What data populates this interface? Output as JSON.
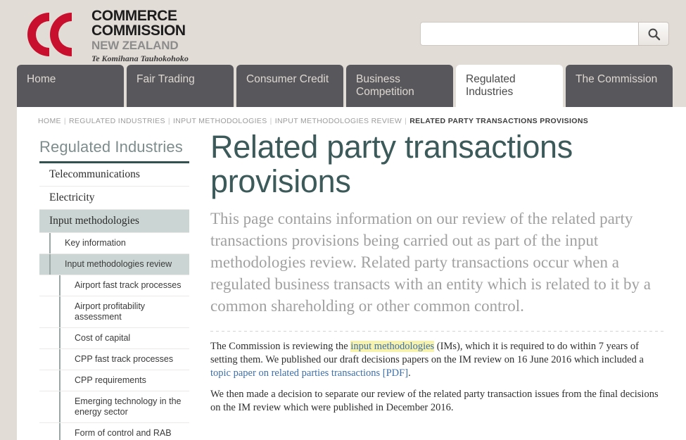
{
  "brand": {
    "line1": "COMMERCE",
    "line2": "COMMISSION",
    "line3": "NEW ZEALAND",
    "line4": "Te Komihana Tauhokohoko",
    "logo_color": "#c8102e",
    "logo_icon": "double-c-logo-icon"
  },
  "search": {
    "value": "",
    "placeholder": "",
    "icon": "search-icon",
    "button_label": ""
  },
  "tabs": [
    {
      "label": "Home",
      "active": false
    },
    {
      "label": "Fair Trading",
      "active": false
    },
    {
      "label": "Consumer Credit",
      "active": false
    },
    {
      "label": "Business Competition",
      "active": false
    },
    {
      "label": "Regulated Industries",
      "active": true
    },
    {
      "label": "The Commission",
      "active": false
    }
  ],
  "breadcrumb": {
    "items": [
      {
        "label": "HOME",
        "current": false
      },
      {
        "label": "REGULATED INDUSTRIES",
        "current": false
      },
      {
        "label": "INPUT METHODOLOGIES",
        "current": false
      },
      {
        "label": "INPUT METHODOLOGIES REVIEW",
        "current": false
      },
      {
        "label": "RELATED PARTY TRANSACTIONS PROVISIONS",
        "current": true
      }
    ],
    "separator": "|"
  },
  "sidebar": {
    "title": "Regulated Industries",
    "items": [
      {
        "label": "Telecommunications",
        "level": 1,
        "selected": false
      },
      {
        "label": "Electricity",
        "level": 1,
        "selected": false
      },
      {
        "label": "Input methodologies",
        "level": 1,
        "selected": true
      },
      {
        "label": "Key information",
        "level": 2,
        "selected": false
      },
      {
        "label": "Input methodologies review",
        "level": 2,
        "selected": true
      },
      {
        "label": "Airport fast track processes",
        "level": 3,
        "selected": false
      },
      {
        "label": "Airport profitability assessment",
        "level": 3,
        "selected": false
      },
      {
        "label": "Cost of capital",
        "level": 3,
        "selected": false
      },
      {
        "label": "CPP fast track processes",
        "level": 3,
        "selected": false
      },
      {
        "label": "CPP requirements",
        "level": 3,
        "selected": false
      },
      {
        "label": "Emerging technology in the energy sector",
        "level": 3,
        "selected": false
      },
      {
        "label": "Form of control and RAB",
        "level": 3,
        "selected": false
      }
    ]
  },
  "main": {
    "title": "Related party transactions provisions",
    "intro": "This page contains information on our review of the related party transactions provisions being carried out as part of the input methodologies review.  Related party transactions occur when a regulated business transacts with an entity which is related to it by a common shareholding or other common control.",
    "paragraph1": {
      "before_highlight": "The Commission is reviewing the ",
      "highlight_link": "input methodologies",
      "after_highlight": " (IMs), which it is required to do within 7 years of setting them. We published our draft decisions papers on the IM review on 16 June 2016 which included a ",
      "link": "topic paper on related parties transactions [PDF]",
      "tail": "."
    },
    "paragraph2": "We then made a decision to separate our review of the related party transaction issues from the final decisions on the IM review which were published in December 2016."
  }
}
